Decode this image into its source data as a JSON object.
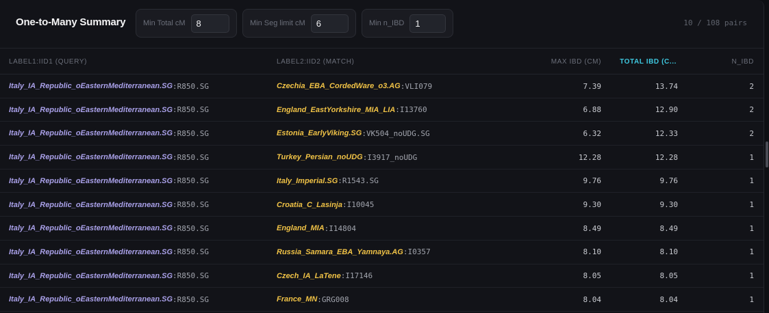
{
  "header": {
    "title": "One-to-Many Summary",
    "filters": [
      {
        "label": "Min Total cM",
        "value": "8"
      },
      {
        "label": "Min Seg limit cM",
        "value": "6"
      },
      {
        "label": "Min n_IBD",
        "value": "1"
      }
    ],
    "pairs_count": "10 / 108 pairs"
  },
  "table": {
    "columns": [
      "LABEL1:IID1 (QUERY)",
      "LABEL2:IID2 (MATCH)",
      "MAX IBD (CM)",
      "TOTAL IBD (C...",
      "N_IBD"
    ],
    "active_column": "TOTAL IBD (C...",
    "rows": [
      {
        "label1": "Italy_IA_Republic_oEasternMediterranean.SG",
        "iid1": "R850.SG",
        "label2": "Czechia_EBA_CordedWare_o3.AG",
        "iid2": "VLI079",
        "max_ibd": "7.39",
        "total_ibd": "13.74",
        "n_ibd": "2"
      },
      {
        "label1": "Italy_IA_Republic_oEasternMediterranean.SG",
        "iid1": "R850.SG",
        "label2": "England_EastYorkshire_MIA_LIA",
        "iid2": "I13760",
        "max_ibd": "6.88",
        "total_ibd": "12.90",
        "n_ibd": "2"
      },
      {
        "label1": "Italy_IA_Republic_oEasternMediterranean.SG",
        "iid1": "R850.SG",
        "label2": "Estonia_EarlyViking.SG",
        "iid2": "VK504_noUDG.SG",
        "max_ibd": "6.32",
        "total_ibd": "12.33",
        "n_ibd": "2"
      },
      {
        "label1": "Italy_IA_Republic_oEasternMediterranean.SG",
        "iid1": "R850.SG",
        "label2": "Turkey_Persian_noUDG",
        "iid2": "I3917_noUDG",
        "max_ibd": "12.28",
        "total_ibd": "12.28",
        "n_ibd": "1"
      },
      {
        "label1": "Italy_IA_Republic_oEasternMediterranean.SG",
        "iid1": "R850.SG",
        "label2": "Italy_Imperial.SG",
        "iid2": "R1543.SG",
        "max_ibd": "9.76",
        "total_ibd": "9.76",
        "n_ibd": "1"
      },
      {
        "label1": "Italy_IA_Republic_oEasternMediterranean.SG",
        "iid1": "R850.SG",
        "label2": "Croatia_C_Lasinja",
        "iid2": "I10045",
        "max_ibd": "9.30",
        "total_ibd": "9.30",
        "n_ibd": "1"
      },
      {
        "label1": "Italy_IA_Republic_oEasternMediterranean.SG",
        "iid1": "R850.SG",
        "label2": "England_MIA",
        "iid2": "I14804",
        "max_ibd": "8.49",
        "total_ibd": "8.49",
        "n_ibd": "1"
      },
      {
        "label1": "Italy_IA_Republic_oEasternMediterranean.SG",
        "iid1": "R850.SG",
        "label2": "Russia_Samara_EBA_Yamnaya.AG",
        "iid2": "I0357",
        "max_ibd": "8.10",
        "total_ibd": "8.10",
        "n_ibd": "1"
      },
      {
        "label1": "Italy_IA_Republic_oEasternMediterranean.SG",
        "iid1": "R850.SG",
        "label2": "Czech_IA_LaTene",
        "iid2": "I17146",
        "max_ibd": "8.05",
        "total_ibd": "8.05",
        "n_ibd": "1"
      },
      {
        "label1": "Italy_IA_Republic_oEasternMediterranean.SG",
        "iid1": "R850.SG",
        "label2": "France_MN",
        "iid2": "GRG008",
        "max_ibd": "8.04",
        "total_ibd": "8.04",
        "n_ibd": "1"
      }
    ]
  },
  "separator": ":",
  "colors": {
    "accent": "#3ec8e0",
    "query_label": "#a9a0e8",
    "match_label": "#f0c246",
    "background": "#121318"
  }
}
